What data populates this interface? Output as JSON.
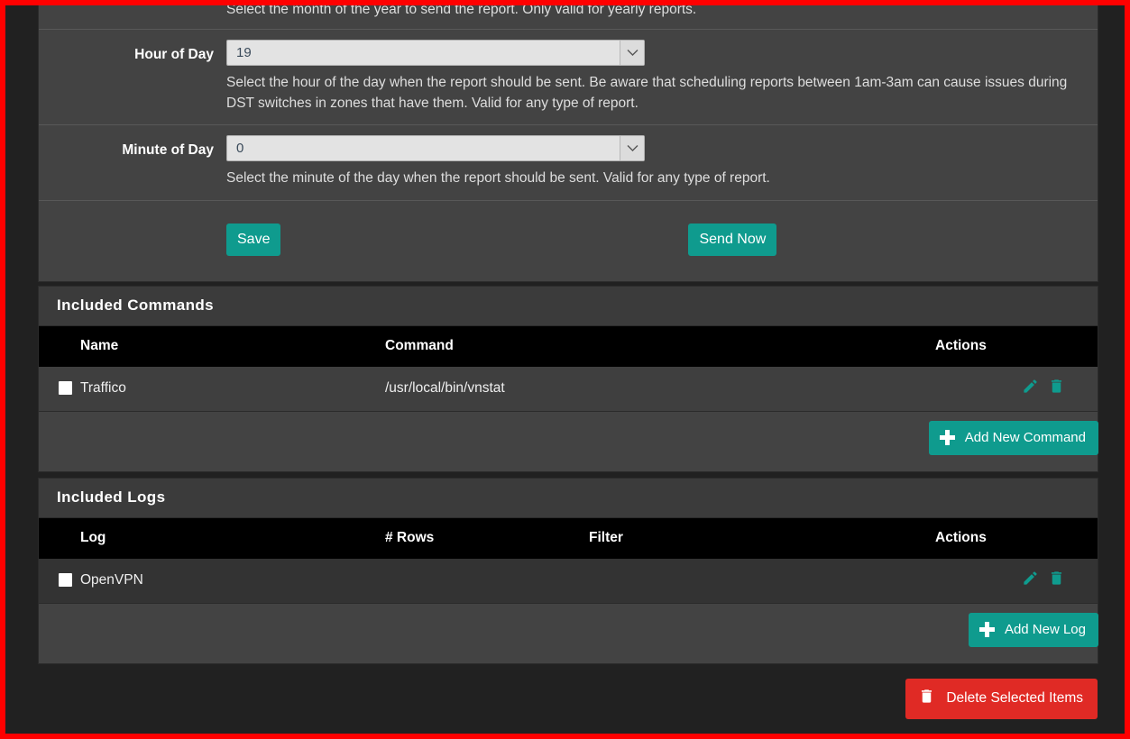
{
  "colors": {
    "accent_teal": "#0f9b8e",
    "danger_red": "#e02a25",
    "panel_bg": "#434343",
    "page_bg": "#212121",
    "header_black": "#000000",
    "border_highlight": "#ff0000"
  },
  "schedule_form": {
    "rows": [
      {
        "label": "",
        "help": "Select the month of the year to send the report. Only valid for yearly reports."
      },
      {
        "label": "Hour of Day",
        "value": "19",
        "help": "Select the hour of the day when the report should be sent. Be aware that scheduling reports between 1am-3am can cause issues during DST switches in zones that have them. Valid for any type of report."
      },
      {
        "label": "Minute of Day",
        "value": "0",
        "help": "Select the minute of the day when the report should be sent. Valid for any type of report."
      }
    ],
    "save_label": "Save",
    "send_now_label": "Send Now"
  },
  "commands_panel": {
    "title": "Included Commands",
    "columns": [
      "Name",
      "Command",
      "Actions"
    ],
    "rows": [
      {
        "name": "Traffico",
        "command": "/usr/local/bin/vnstat",
        "checked": false
      }
    ],
    "add_button_label": "Add New Command",
    "edit_icon": "pencil-icon",
    "delete_icon": "trash-icon"
  },
  "logs_panel": {
    "title": "Included Logs",
    "columns": [
      "Log",
      "# Rows",
      "Filter",
      "Actions"
    ],
    "rows": [
      {
        "log": "OpenVPN",
        "rows": "",
        "filter": "",
        "checked": false
      }
    ],
    "add_button_label": "Add New Log",
    "edit_icon": "pencil-icon",
    "delete_icon": "trash-icon"
  },
  "footer": {
    "delete_selected_label": "Delete Selected Items",
    "delete_icon": "trash-icon"
  }
}
